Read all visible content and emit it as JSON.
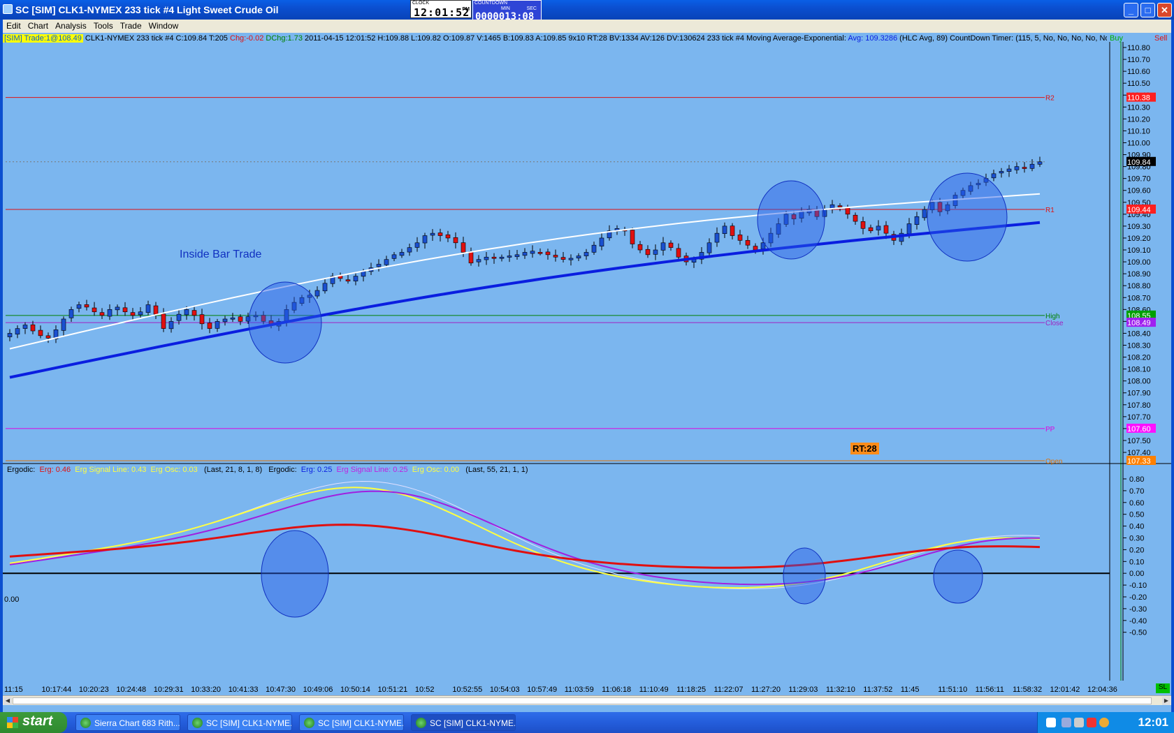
{
  "window": {
    "title": "SC [SIM] CLK1-NYMEX  233 tick  #4  Light Sweet Crude Oil"
  },
  "clock": {
    "label": "CLOCK",
    "time": "12:01:52",
    "ampm": "PM"
  },
  "countdown": {
    "label": "COUNTDOWN",
    "min_label": "MIN",
    "sec_label": "SEC",
    "value": "0000013:08"
  },
  "menu": [
    "Edit",
    "Chart",
    "Analysis",
    "Tools",
    "Trade",
    "Window"
  ],
  "infoline": {
    "sim": "[SIM]  Trade:1@108.49",
    "text": "CLK1-NYMEX  233 tick  #4 C:109.84 T:205",
    "chg": "Chg:-0.02",
    "dchg": "DChg:1.73",
    "rest": "2011-04-15 12:01:52 H:109.88 L:109.82 O:109.87 V:1465 B:109.83 A:109.85 9x10 RT:28 BV:1334 AV:126 DV:130624 233 tick #4  Moving Average-Exponential:",
    "avg": "Avg: 109.3286",
    "hlc": "(HLC Avg, 89)  CountDown Timer:   (115, 5, No, No, No, No, No)",
    "buy": "Buy",
    "sell": "Sell"
  },
  "subinfo": {
    "e1": "Ergodic:",
    "e1erg": "Erg: 0.46",
    "e1sig": "Erg Signal Line: 0.43",
    "e1osc": "Erg Osc: 0.03",
    "e1p": "(Last, 21, 8, 1, 8)",
    "e2": "Ergodic:",
    "e2erg": "Erg: 0.25",
    "e2sig": "Erg Signal Line: 0.25",
    "e2osc": "Erg Osc: 0.00",
    "e2p": "(Last, 55, 21, 1, 1)"
  },
  "annotation": "Inside Bar Trade",
  "rt_label": "RT:28",
  "zero_label": "0.00",
  "sl_label": "SL",
  "price_axis": [
    "110.80",
    "110.70",
    "110.60",
    "110.50",
    "110.40",
    "110.30",
    "110.20",
    "110.10",
    "110.00",
    "109.90",
    "109.80",
    "109.70",
    "109.60",
    "109.50",
    "109.40",
    "109.30",
    "109.20",
    "109.10",
    "109.00",
    "108.90",
    "108.80",
    "108.70",
    "108.60",
    "108.50",
    "108.40",
    "108.30",
    "108.20",
    "108.10",
    "108.00",
    "107.90",
    "107.80",
    "107.70",
    "107.60",
    "107.50",
    "107.40"
  ],
  "osc_axis": [
    "0.80",
    "0.70",
    "0.60",
    "0.50",
    "0.40",
    "0.30",
    "0.20",
    "0.10",
    "0.00",
    "-0.10",
    "-0.20",
    "-0.30",
    "-0.40",
    "-0.50"
  ],
  "levels": [
    {
      "name": "R2",
      "price": 110.38,
      "color": "#e01010",
      "tag": "110.38",
      "tagbg": "#ff2020"
    },
    {
      "name": "R1",
      "price": 109.44,
      "color": "#e01010",
      "tag": "109.44",
      "tagbg": "#ff2020"
    },
    {
      "name": "High",
      "price": 108.55,
      "color": "#008000",
      "tag": "108.55",
      "tagbg": "#00a000"
    },
    {
      "name": "Close",
      "price": 108.49,
      "color": "#a020c0",
      "tag": "108.49",
      "tagbg": "#a020f0"
    },
    {
      "name": "PP",
      "price": 107.6,
      "color": "#e000e0",
      "tag": "107.60",
      "tagbg": "#ff10ff"
    },
    {
      "name": "Open",
      "price": 107.33,
      "color": "#e07000",
      "tag": "107.33",
      "tagbg": "#ff8000"
    }
  ],
  "last_price": {
    "tag": "109.84",
    "price": 109.84
  },
  "time_axis": [
    "11:15",
    "10:17:44",
    "10:20:23",
    "10:24:48",
    "10:29:31",
    "10:33:20",
    "10:41:33",
    "10:47:30",
    "10:49:06",
    "10:50:14",
    "10:51:21",
    "10:52",
    "10:52:55",
    "10:54:03",
    "10:57:49",
    "11:03:59",
    "11:06:18",
    "11:10:49",
    "11:18:25",
    "11:22:07",
    "11:27:20",
    "11:29:03",
    "11:32:10",
    "11:37:52",
    "11:45",
    "11:51:10",
    "11:56:11",
    "11:58:32",
    "12:01:42",
    "12:04:36"
  ],
  "colors": {
    "bg": "#7bb6ef",
    "bull": "#1a50d0",
    "bear": "#e01010",
    "ema_fast": "#ffffff",
    "ema_slow": "#0a1ee0"
  },
  "chart_data": {
    "type": "candlestick",
    "price_closes": [
      108.4,
      108.44,
      108.47,
      108.42,
      108.38,
      108.36,
      108.43,
      108.52,
      108.6,
      108.64,
      108.62,
      108.58,
      108.55,
      108.6,
      108.62,
      108.58,
      108.55,
      108.58,
      108.64,
      108.56,
      108.44,
      108.5,
      108.56,
      108.6,
      108.55,
      108.48,
      108.44,
      108.5,
      108.52,
      108.53,
      108.5,
      108.54,
      108.55,
      108.5,
      108.47,
      108.5,
      108.6,
      108.66,
      108.7,
      108.72,
      108.76,
      108.82,
      108.88,
      108.86,
      108.84,
      108.88,
      108.92,
      108.95,
      108.98,
      109.02,
      109.06,
      109.08,
      109.12,
      109.16,
      109.22,
      109.24,
      109.22,
      109.2,
      109.16,
      109.08,
      108.99,
      109.02,
      109.04,
      109.03,
      109.04,
      109.05,
      109.06,
      109.08,
      109.09,
      109.08,
      109.06,
      109.04,
      109.02,
      109.03,
      109.05,
      109.08,
      109.14,
      109.2,
      109.26,
      109.28,
      109.26,
      109.15,
      109.1,
      109.06,
      109.1,
      109.16,
      109.12,
      109.04,
      109.0,
      109.02,
      109.08,
      109.16,
      109.24,
      109.3,
      109.22,
      109.18,
      109.14,
      109.1,
      109.16,
      109.24,
      109.32,
      109.4,
      109.36,
      109.42,
      109.44,
      109.38,
      109.44,
      109.48,
      109.46,
      109.4,
      109.34,
      109.28,
      109.26,
      109.3,
      109.24,
      109.18,
      109.24,
      109.32,
      109.38,
      109.44,
      109.5,
      109.42,
      109.48,
      109.56,
      109.6,
      109.64,
      109.66,
      109.7,
      109.74,
      109.76,
      109.78,
      109.8,
      109.79,
      109.82,
      109.84
    ],
    "ema_fast": {
      "start": 108.27,
      "end": 109.57
    },
    "ema_slow": {
      "start": 108.03,
      "end": 109.33
    },
    "oscillator_range": [
      -0.55,
      0.85
    ],
    "highlight_circles": [
      "10:47:30",
      "11:29:03",
      "11:56:11"
    ]
  }
}
